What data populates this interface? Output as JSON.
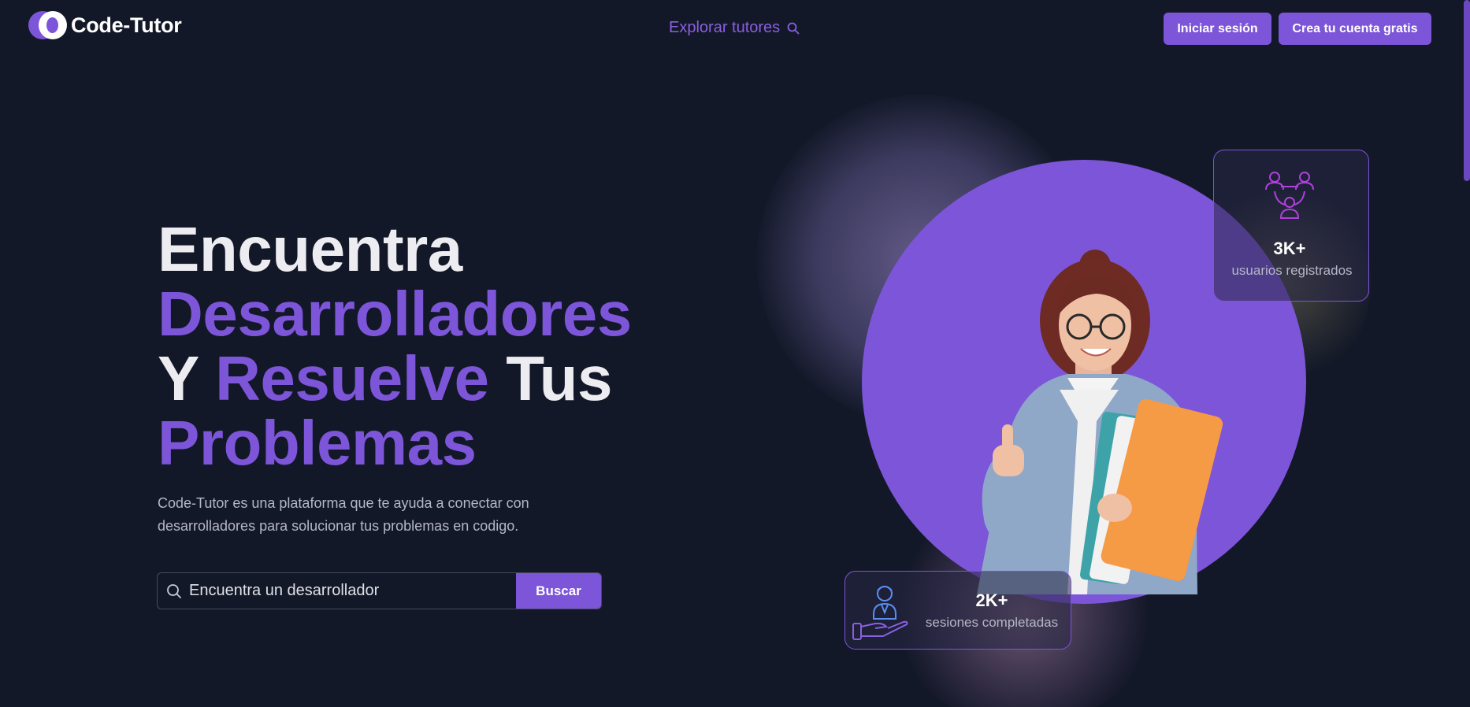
{
  "header": {
    "logo_text": "Code-Tutor",
    "explore_label": "Explorar tutores",
    "login_label": "Iniciar sesión",
    "signup_label": "Crea tu cuenta gratis"
  },
  "hero": {
    "title_line1": "Encuentra",
    "title_line2": "Desarrolladores",
    "title_line3_a": "Y",
    "title_line3_b": "Resuelve",
    "title_line3_c": "Tus",
    "title_line4": "Problemas",
    "description": "Code-Tutor es una plataforma que te ayuda a conectar con desarrolladores para solucionar tus problemas en codigo."
  },
  "search": {
    "placeholder": "Encuentra un desarrollador",
    "button_label": "Buscar"
  },
  "stats": {
    "users": {
      "value": "3K+",
      "label": "usuarios registrados",
      "icon": "users-network-icon"
    },
    "sessions": {
      "value": "2K+",
      "label": "sesiones completadas",
      "icon": "tutor-hand-icon"
    }
  },
  "image": {
    "icon": "student-photo"
  },
  "colors": {
    "background": "#131828",
    "accent": "#7d55d9",
    "text": "#ececf1",
    "muted": "#b5b6c6"
  }
}
